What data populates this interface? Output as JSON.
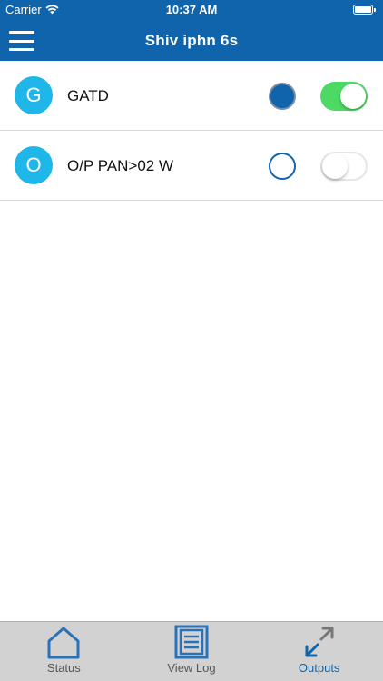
{
  "status_bar": {
    "carrier": "Carrier",
    "time": "10:37 AM"
  },
  "nav": {
    "title": "Shiv iphn 6s"
  },
  "outputs": [
    {
      "initial": "G",
      "label": "GATD",
      "state": "on",
      "toggle_on": true
    },
    {
      "initial": "O",
      "label": "O/P PAN>02 W",
      "state": "off",
      "toggle_on": false
    }
  ],
  "tabs": [
    {
      "label": "Status",
      "icon": "home-icon",
      "active": false
    },
    {
      "label": "View Log",
      "icon": "log-icon",
      "active": false
    },
    {
      "label": "Outputs",
      "icon": "expand-arrows-icon",
      "active": true
    }
  ],
  "colors": {
    "brand_blue": "#0f64ac",
    "avatar_cyan": "#1fb6ea",
    "toggle_green": "#4cd964",
    "tabbar_gray": "#d2d2d2"
  }
}
